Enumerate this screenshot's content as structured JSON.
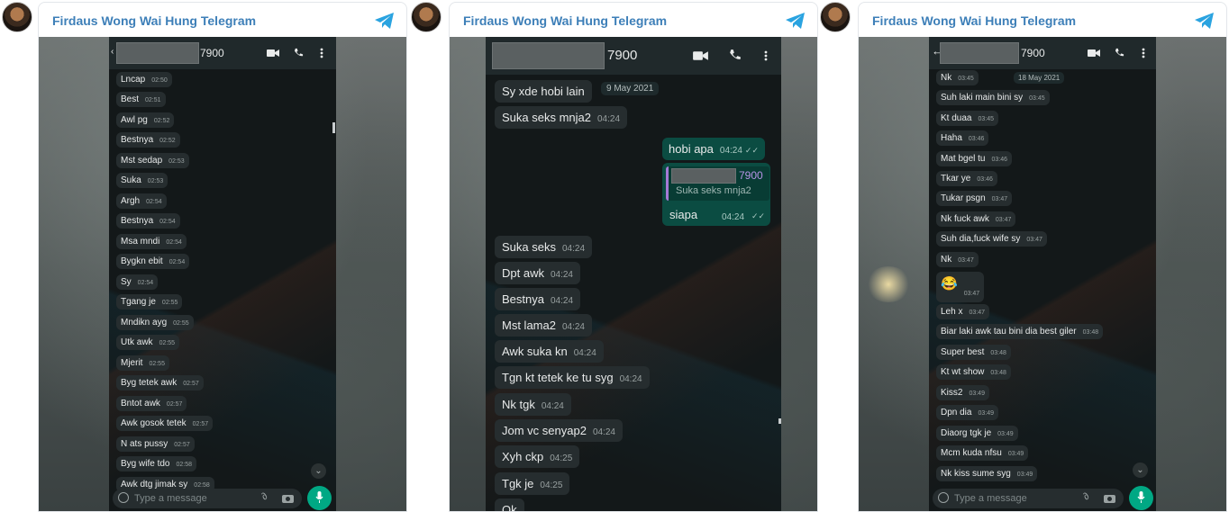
{
  "panels": [
    {
      "title": "Firdaus Wong Wai Hung Telegram",
      "contact_suffix": "7900",
      "input_placeholder": "Type a message",
      "messages": [
        {
          "text": "Lncap",
          "time": "02:50"
        },
        {
          "text": "Best",
          "time": "02:51"
        },
        {
          "text": "Awl pg",
          "time": "02:52"
        },
        {
          "text": "Bestnya",
          "time": "02:52"
        },
        {
          "text": "Mst sedap",
          "time": "02:53"
        },
        {
          "text": "Suka",
          "time": "02:53"
        },
        {
          "text": "Argh",
          "time": "02:54"
        },
        {
          "text": "Bestnya",
          "time": "02:54"
        },
        {
          "text": "Msa mndi",
          "time": "02:54"
        },
        {
          "text": "Bygkn ebit",
          "time": "02:54"
        },
        {
          "text": "Sy",
          "time": "02:54"
        },
        {
          "text": "Tgang je",
          "time": "02:55"
        },
        {
          "text": "Mndikn ayg",
          "time": "02:55"
        },
        {
          "text": "Utk awk",
          "time": "02:55"
        },
        {
          "text": "Mjerit",
          "time": "02:55"
        },
        {
          "text": "Byg tetek awk",
          "time": "02:57"
        },
        {
          "text": "Bntot awk",
          "time": "02:57"
        },
        {
          "text": "Awk gosok tetek",
          "time": "02:57"
        },
        {
          "text": "N ats pussy",
          "time": "02:57"
        },
        {
          "text": "Byg wife tdo",
          "time": "02:58"
        },
        {
          "text": "Awk dtg jimak sy",
          "time": "02:58"
        }
      ]
    },
    {
      "title": "Firdaus Wong Wai Hung Telegram",
      "contact_suffix": "7900",
      "date_chip": "9 May 2021",
      "messages_top": [
        {
          "text": "Sy xde hobi lain",
          "time": ""
        },
        {
          "text": "Suka seks mnja2",
          "time": "04:24"
        }
      ],
      "outgoing": [
        {
          "text": "hobi apa",
          "time": "04:24"
        }
      ],
      "reply": {
        "quoted_suffix": "7900",
        "quoted_text": "Suka seks mnja2",
        "text": "siapa",
        "time": "04:24"
      },
      "messages": [
        {
          "text": "Suka seks",
          "time": "04:24"
        },
        {
          "text": "Dpt awk",
          "time": "04:24"
        },
        {
          "text": "Bestnya",
          "time": "04:24"
        },
        {
          "text": "Mst lama2",
          "time": "04:24"
        },
        {
          "text": "Awk suka kn",
          "time": "04:24"
        },
        {
          "text": "Tgn kt tetek ke tu syg",
          "time": "04:24"
        },
        {
          "text": "Nk tgk",
          "time": "04:24"
        },
        {
          "text": "Jom vc senyap2",
          "time": "04:24"
        },
        {
          "text": "Xyh ckp",
          "time": "04:25"
        },
        {
          "text": "Tgk je",
          "time": "04:25"
        },
        {
          "text": "Ok",
          "time": ""
        }
      ]
    },
    {
      "title": "Firdaus Wong Wai Hung Telegram",
      "contact_suffix": "7900",
      "date_chip": "18 May 2021",
      "input_placeholder": "Type a message",
      "messages": [
        {
          "text": "Nk",
          "time": "03:45"
        },
        {
          "text": "Suh laki main bini sy",
          "time": "03:45"
        },
        {
          "text": "Kt duaa",
          "time": "03:45"
        },
        {
          "text": "Haha",
          "time": "03:46"
        },
        {
          "text": "Mat bgel tu",
          "time": "03:46"
        },
        {
          "text": "Tkar ye",
          "time": "03:46"
        },
        {
          "text": "Tukar psgn",
          "time": "03:47"
        },
        {
          "text": "Nk fuck awk",
          "time": "03:47"
        },
        {
          "text": "Suh dia,fuck wife sy",
          "time": "03:47"
        },
        {
          "text": "Nk",
          "time": "03:47"
        },
        {
          "text": "😂",
          "time": "03:47"
        },
        {
          "text": "Leh x",
          "time": "03:47"
        },
        {
          "text": "Biar laki awk tau bini dia best giler",
          "time": "03:48"
        },
        {
          "text": "Super best",
          "time": "03:48"
        },
        {
          "text": "Kt wt show",
          "time": "03:48"
        },
        {
          "text": "Kiss2",
          "time": "03:49"
        },
        {
          "text": "Dpn dia",
          "time": "03:49"
        },
        {
          "text": "Diaorg tgk je",
          "time": "03:49"
        },
        {
          "text": "Mcm kuda nfsu",
          "time": "03:49"
        },
        {
          "text": "Nk kiss sume syg",
          "time": "03:49"
        }
      ]
    }
  ],
  "colors": {
    "telegram_blue": "#2aa3e0",
    "title_blue": "#3d7fb8",
    "bubble_in": "#262d2f",
    "bubble_out": "#0b4c42",
    "mic_green": "#00a884"
  },
  "icons": [
    "telegram-icon",
    "video-call-icon",
    "phone-icon",
    "more-icon",
    "emoji-icon",
    "attach-icon",
    "camera-icon",
    "mic-icon",
    "chevron-down-icon",
    "back-arrow-icon",
    "double-check-icon"
  ]
}
